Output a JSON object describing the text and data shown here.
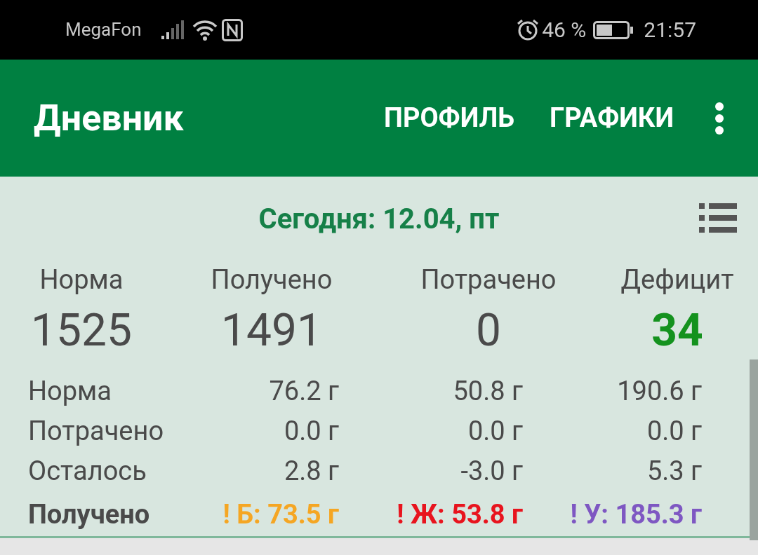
{
  "status_bar": {
    "carrier": "MegaFon",
    "battery_percent": "46 %",
    "time": "21:57"
  },
  "app_bar": {
    "title": "Дневник",
    "actions": [
      "ПРОФИЛЬ",
      "ГРАФИКИ"
    ]
  },
  "date_header": "Сегодня: 12.04, пт",
  "summary": [
    {
      "label": "Норма",
      "value": "1525",
      "kind": "plain"
    },
    {
      "label": "Получено",
      "value": "1491",
      "kind": "plain"
    },
    {
      "label": "Потрачено",
      "value": "0",
      "kind": "plain"
    },
    {
      "label": "Дефицит",
      "value": "34",
      "kind": "deficit"
    }
  ],
  "macros": {
    "rows": [
      {
        "label": "Норма",
        "values": [
          "76.2 г",
          "50.8 г",
          "190.6 г"
        ]
      },
      {
        "label": "Потрачено",
        "values": [
          "0.0 г",
          "0.0 г",
          "0.0 г"
        ]
      },
      {
        "label": "Осталось",
        "values": [
          "2.8 г",
          "-3.0 г",
          "5.3 г"
        ]
      }
    ],
    "received": {
      "label": "Получено",
      "items": [
        {
          "text": "! Б: 73.5 г",
          "color": "#f5a623"
        },
        {
          "text": "! Ж: 53.8 г",
          "color": "#e8141e"
        },
        {
          "text": "! У: 185.3 г",
          "color": "#7e57c2"
        }
      ]
    }
  }
}
